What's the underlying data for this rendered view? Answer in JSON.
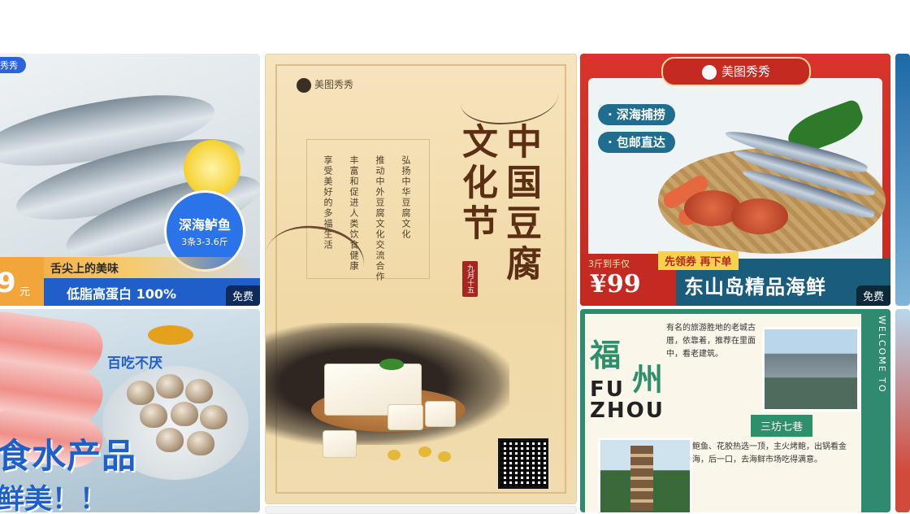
{
  "cards": {
    "fish": {
      "brand": "秀秀",
      "circle_title": "深海鲈鱼",
      "circle_sub": "3条3-3.6斤",
      "tagline": "舌尖上的美味",
      "price_num": "9",
      "price_unit": "元",
      "claim": "低脂高蛋白 100%",
      "badge": "免费"
    },
    "seafood": {
      "tag": "百吃不厌",
      "big_line1": "食水产品",
      "big_line2": "鲜美！！"
    },
    "tofu": {
      "logo": "美图秀秀",
      "col1": "弘扬中华豆腐文化",
      "col2": "推动中外豆腐文化交流合作",
      "col3": "丰富和促进人类饮食健康",
      "col4": "享受美好的多福生活",
      "title_col1": "中国豆腐",
      "title_col2": "文化节",
      "seal": "九月十五"
    },
    "promo": {
      "brand": "美图秀秀",
      "pill1": "· 深海捕捞",
      "pill2": "· 包邮直达",
      "price_small": "3斤到手仅",
      "price": "¥99",
      "coupon": "先领券 再下单",
      "name": "东山岛精品海鲜",
      "badge": "免费"
    },
    "travel": {
      "cn1": "福",
      "cn2": "州",
      "en1": "FU",
      "en2": "ZHOU",
      "note1": "有名的旅游胜地的老城古厝，依靠着，推荐在里面中，看老建筑。",
      "tag": "三坊七巷",
      "note2": "鲍鱼、花胶热选一顶，主火烤鲍，出锅看金海，后一口，去海鲜市场吃得满意。",
      "side": "WELCOME TO"
    }
  },
  "colors": {
    "blue": "#1f5fc9",
    "orange": "#f2a53a",
    "red": "#c52a22",
    "teal": "#1a5c7c",
    "green": "#2d8f6b",
    "brown": "#5b2f14"
  }
}
